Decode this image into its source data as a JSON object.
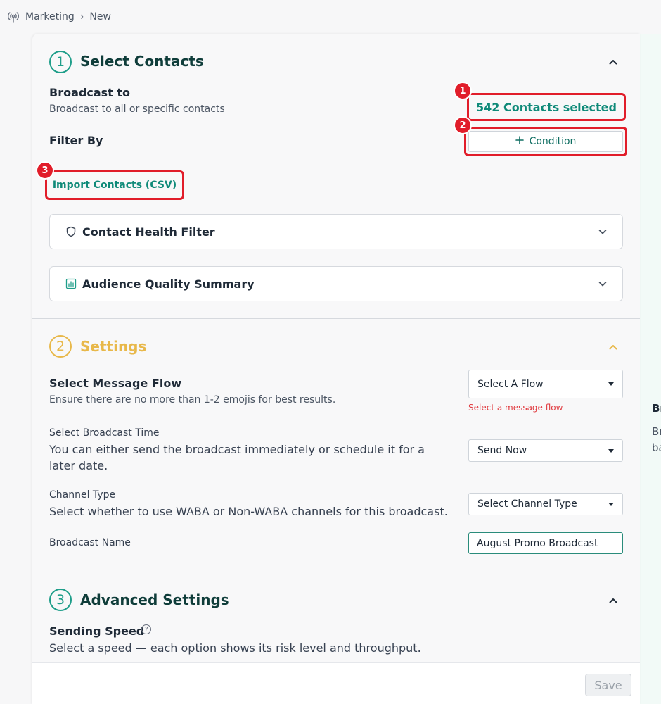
{
  "breadcrumb": {
    "root": "Marketing",
    "current": "New"
  },
  "right_panel": {
    "title": "Br",
    "line1": "Br",
    "line2": "ba"
  },
  "section1": {
    "number": "1",
    "title": "Select Contacts",
    "broadcast_to_label": "Broadcast to",
    "broadcast_to_desc": "Broadcast to all or specific contacts",
    "contacts_selected": "542 Contacts selected",
    "filter_by_label": "Filter By",
    "condition_button": "Condition",
    "import_button": "Import Contacts (CSV)",
    "contact_health_filter": "Contact Health Filter",
    "audience_quality_summary": "Audience Quality Summary"
  },
  "badges": {
    "b1": "1",
    "b2": "2",
    "b3": "3"
  },
  "section2": {
    "number": "2",
    "title": "Settings",
    "message_flow_label": "Select Message Flow",
    "message_flow_desc": "Ensure there are no more than 1-2 emojis for best results.",
    "message_flow_select": "Select A Flow",
    "message_flow_error": "Select a message flow",
    "broadcast_time_label": "Select Broadcast Time",
    "broadcast_time_desc": "You can either send the broadcast immediately or schedule it for a later date.",
    "broadcast_time_select": "Send Now",
    "channel_type_label": "Channel Type",
    "channel_type_desc": "Select whether to use WABA or Non-WABA channels for this broadcast.",
    "channel_type_select": "Select Channel Type",
    "broadcast_name_label": "Broadcast Name",
    "broadcast_name_value": "August Promo Broadcast"
  },
  "section3": {
    "number": "3",
    "title": "Advanced Settings",
    "sending_speed_label": "Sending Speed",
    "sending_speed_desc": "Select a speed — each option shows its risk level and throughput."
  },
  "footer": {
    "save_label": "Save"
  },
  "colors": {
    "accent_teal": "#1f9e8a",
    "settings_yellow": "#e8b84a",
    "highlight_red": "#e11d2a",
    "error_red": "#e0393e"
  }
}
